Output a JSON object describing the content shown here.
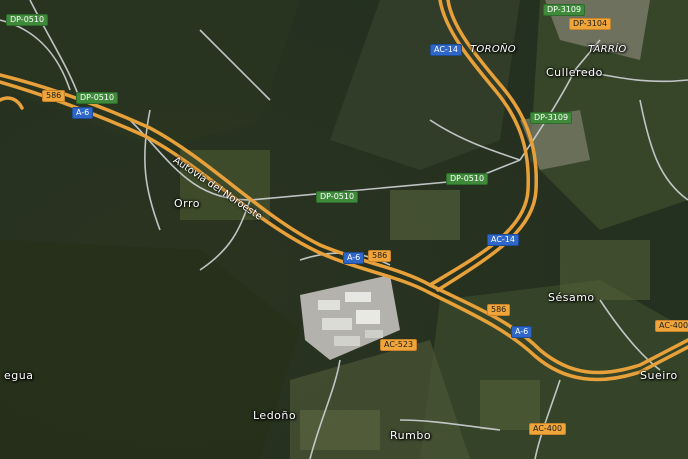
{
  "map": {
    "places": [
      {
        "id": "toroño",
        "label": "TOROÑO",
        "style": "italic"
      },
      {
        "id": "tarrio",
        "label": "TARRÍO",
        "style": "italic"
      },
      {
        "id": "culleredo",
        "label": "Culleredo",
        "style": "normal"
      },
      {
        "id": "orro",
        "label": "Orro",
        "style": "normal"
      },
      {
        "id": "sesamo",
        "label": "Sésamo",
        "style": "normal"
      },
      {
        "id": "sueiro",
        "label": "Sueiro",
        "style": "normal"
      },
      {
        "id": "ledono",
        "label": "Ledoño",
        "style": "normal"
      },
      {
        "id": "rumbo",
        "label": "Rumbo",
        "style": "normal"
      },
      {
        "id": "egua",
        "label": "egua",
        "style": "normal"
      }
    ],
    "road_name": "Autovía del Noroeste",
    "shields": [
      {
        "id": "dp0510-nw",
        "label": "DP-0510",
        "color": "green"
      },
      {
        "id": "dp0510-w",
        "label": "DP-0510",
        "color": "green"
      },
      {
        "id": "dp0510-c",
        "label": "DP-0510",
        "color": "green"
      },
      {
        "id": "dp0510-e",
        "label": "DP-0510",
        "color": "green"
      },
      {
        "id": "dp3109-n",
        "label": "DP-3109",
        "color": "green"
      },
      {
        "id": "dp3109-s",
        "label": "DP-3109",
        "color": "green"
      },
      {
        "id": "dp3104",
        "label": "DP-3104",
        "color": "orange"
      },
      {
        "id": "ac14-n",
        "label": "AC-14",
        "color": "blue"
      },
      {
        "id": "ac14-s",
        "label": "AC-14",
        "color": "blue"
      },
      {
        "id": "a6-w",
        "label": "A-6",
        "color": "blue"
      },
      {
        "id": "a6-c",
        "label": "A-6",
        "color": "blue"
      },
      {
        "id": "a6-e",
        "label": "A-6",
        "color": "blue"
      },
      {
        "id": "n586-w",
        "label": "586",
        "color": "orange"
      },
      {
        "id": "n586-c",
        "label": "586",
        "color": "orange"
      },
      {
        "id": "n586-e",
        "label": "586",
        "color": "orange"
      },
      {
        "id": "ac523",
        "label": "AC-523",
        "color": "orange"
      },
      {
        "id": "ac400-e",
        "label": "AC-400",
        "color": "orange"
      },
      {
        "id": "ac400-s",
        "label": "AC-400",
        "color": "orange"
      }
    ],
    "colors": {
      "highway": "#e8a13a",
      "secondary_road": "#cfd3d6",
      "terrain_dark": "#2f3a24",
      "terrain_field": "#5a6b3e"
    }
  }
}
